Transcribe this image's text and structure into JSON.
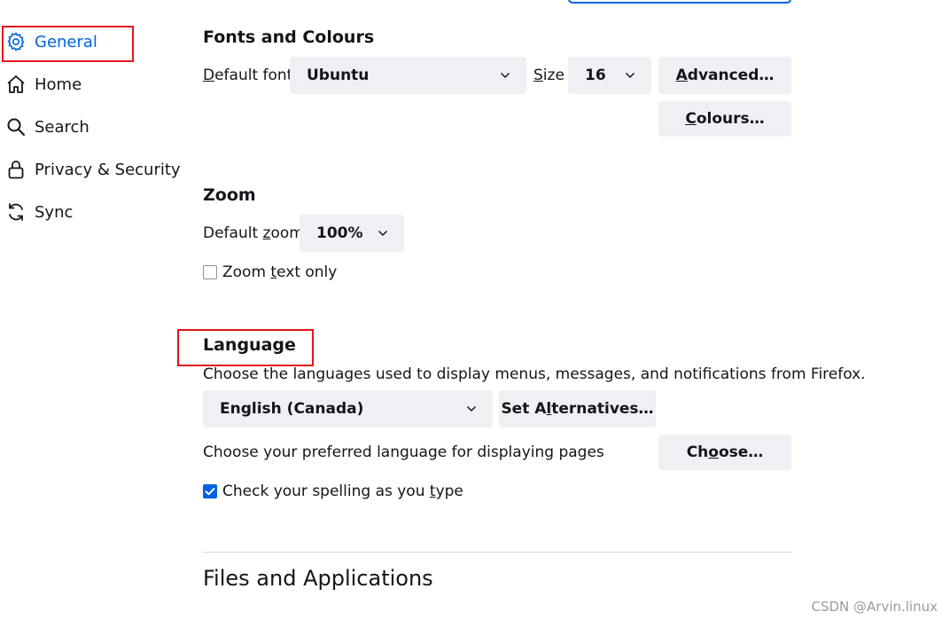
{
  "sidebar": {
    "items": [
      {
        "label": "General",
        "icon": "gear-icon",
        "selected": true
      },
      {
        "label": "Home",
        "icon": "home-icon"
      },
      {
        "label": "Search",
        "icon": "search-icon"
      },
      {
        "label": "Privacy & Security",
        "icon": "lock-icon"
      },
      {
        "label": "Sync",
        "icon": "sync-icon"
      }
    ]
  },
  "fonts": {
    "heading": "Fonts and Colours",
    "default_font_label_accesskey": "D",
    "default_font_label_rest": "efault font",
    "default_font_value": "Ubuntu",
    "size_label_accesskey": "S",
    "size_label_rest": "ize",
    "size_value": "16",
    "advanced_button_accesskey": "A",
    "advanced_button_rest": "dvanced…",
    "colours_button_accesskey": "C",
    "colours_button_rest": "olours…"
  },
  "zoom": {
    "heading": "Zoom",
    "default_zoom_label_pre": "Default ",
    "default_zoom_label_accesskey": "z",
    "default_zoom_label_post": "oom",
    "default_zoom_value": "100%",
    "zoom_text_only_pre": "Zoom ",
    "zoom_text_only_accesskey": "t",
    "zoom_text_only_post": "ext only",
    "zoom_text_only_checked": false
  },
  "language": {
    "heading": "Language",
    "description": "Choose the languages used to display menus, messages, and notifications from Firefox.",
    "language_value": "English (Canada)",
    "set_alternatives_pre": "Set A",
    "set_alternatives_accesskey": "l",
    "set_alternatives_post": "ternatives…",
    "preferred_label": "Choose your preferred language for displaying pages",
    "choose_button_pre": "Ch",
    "choose_button_accesskey": "o",
    "choose_button_post": "ose…",
    "spellcheck_pre": "Check your spelling as you ",
    "spellcheck_accesskey": "t",
    "spellcheck_post": "ype",
    "spellcheck_checked": true
  },
  "files": {
    "heading": "Files and Applications"
  },
  "watermark": "CSDN @Arvin.linux",
  "colors": {
    "accent": "#0061e0",
    "annotation": "#e0161c",
    "button_bg": "#f0f0f4"
  }
}
